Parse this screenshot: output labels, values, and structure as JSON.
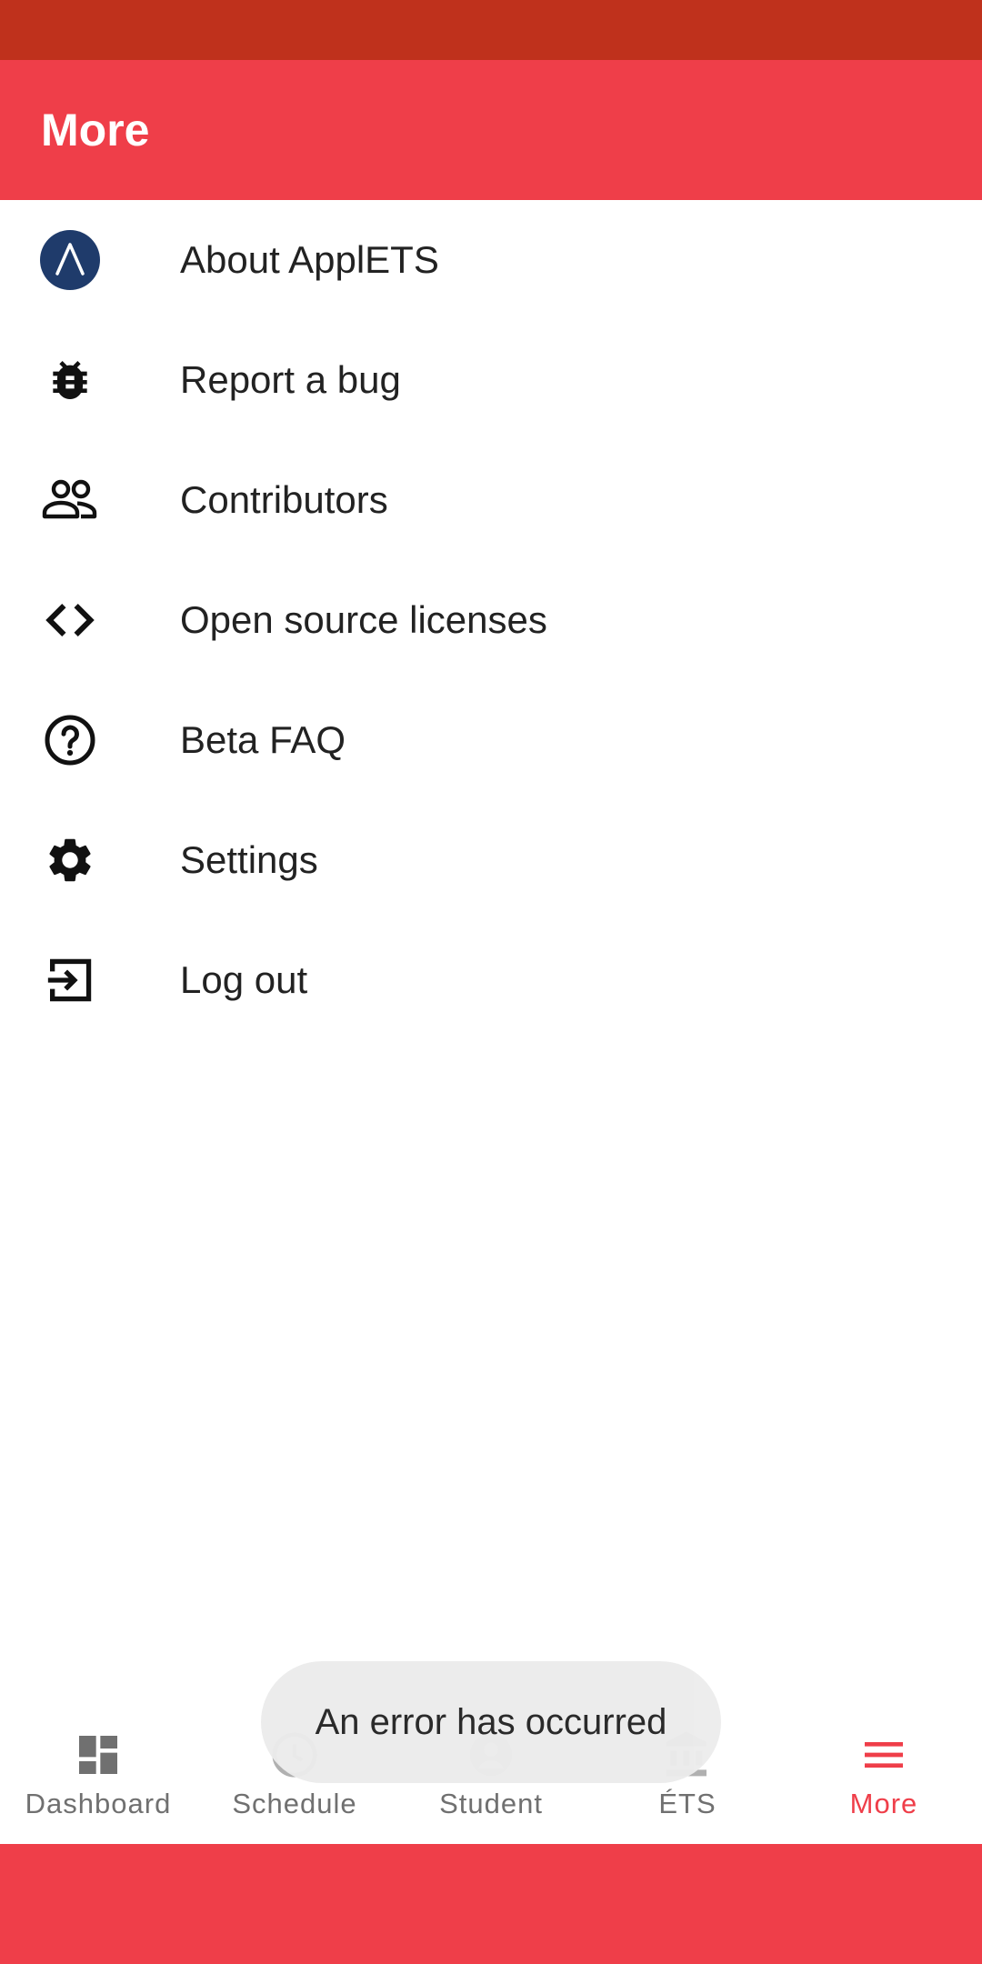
{
  "app_bar": {
    "title": "More"
  },
  "menu": {
    "items": [
      {
        "label": "About ApplETS",
        "icon": "applets-logo-icon"
      },
      {
        "label": "Report a bug",
        "icon": "bug-icon"
      },
      {
        "label": "Contributors",
        "icon": "people-icon"
      },
      {
        "label": "Open source licenses",
        "icon": "code-icon"
      },
      {
        "label": "Beta FAQ",
        "icon": "help-circle-icon"
      },
      {
        "label": "Settings",
        "icon": "gear-icon"
      },
      {
        "label": "Log out",
        "icon": "logout-icon"
      }
    ]
  },
  "toast": {
    "message": "An error has occurred"
  },
  "bottom_nav": {
    "items": [
      {
        "label": "Dashboard",
        "icon": "dashboard-icon",
        "active": false
      },
      {
        "label": "Schedule",
        "icon": "clock-icon",
        "active": false
      },
      {
        "label": "Student",
        "icon": "person-icon",
        "active": false
      },
      {
        "label": "ÉTS",
        "icon": "institution-icon",
        "active": false
      },
      {
        "label": "More",
        "icon": "hamburger-menu-icon",
        "active": true
      }
    ]
  },
  "colors": {
    "status_bar": "#bf311c",
    "primary": "#ef3e49",
    "logo_navy": "#1f3b6b",
    "icon_dark": "#111111",
    "nav_inactive": "#707070"
  }
}
